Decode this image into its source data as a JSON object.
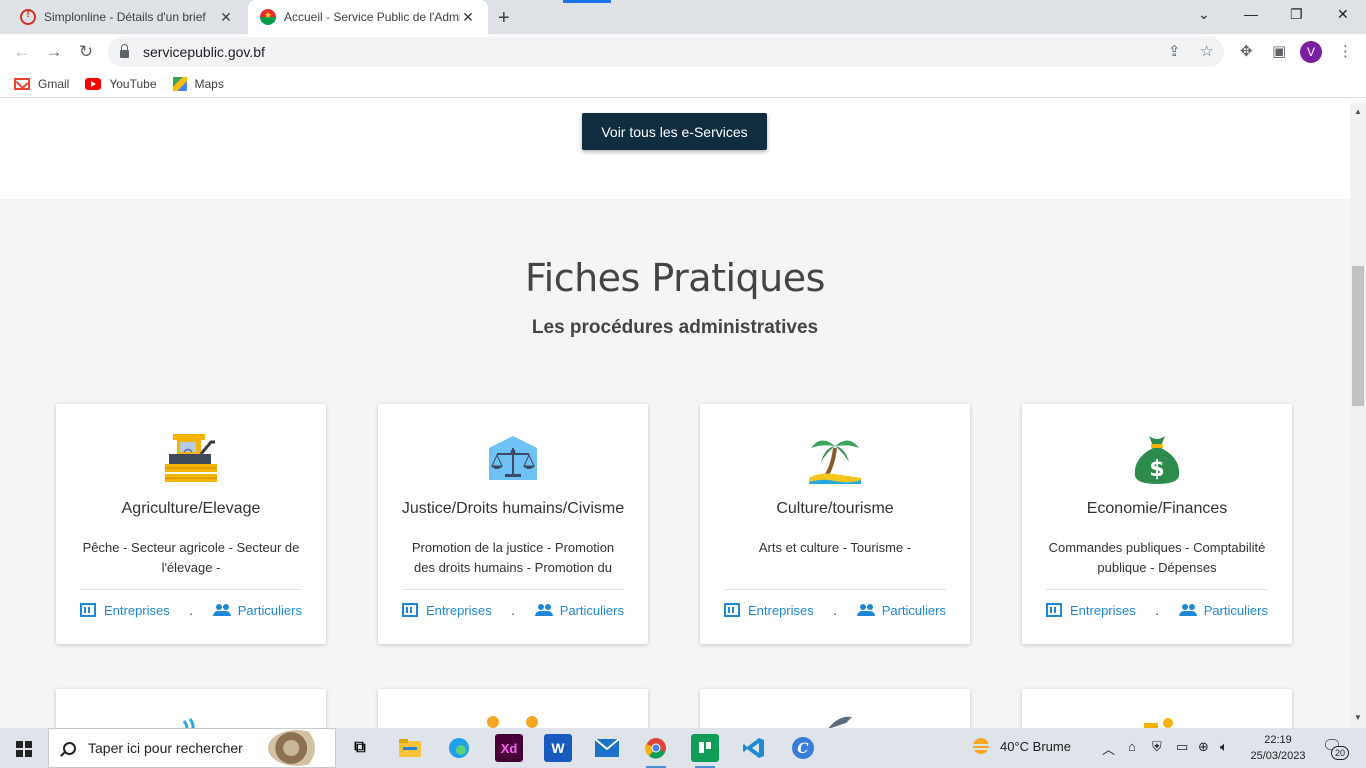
{
  "browser": {
    "tabs": [
      {
        "title": "Simplonline - Détails d'un brief",
        "active": false
      },
      {
        "title": "Accueil - Service Public de l'Admi",
        "active": true
      }
    ],
    "url": "servicepublic.gov.bf",
    "profile_initial": "V",
    "bookmarks": [
      {
        "label": "Gmail",
        "icon": "gmail-icon"
      },
      {
        "label": "YouTube",
        "icon": "youtube-icon"
      },
      {
        "label": "Maps",
        "icon": "maps-icon"
      }
    ]
  },
  "page": {
    "eservices_button": "Voir tous les e-Services",
    "section_title": "Fiches Pratiques",
    "section_subtitle": "Les procédures administratives",
    "link_entreprises": "Entreprises",
    "link_particuliers": "Particuliers",
    "link_separator": ".",
    "cards": [
      {
        "title": "Agriculture/Elevage",
        "description": "Pêche - Secteur agricole - Secteur de l'élevage -",
        "icon": "harvester-icon"
      },
      {
        "title": "Justice/Droits humains/Civisme",
        "description": "Promotion de la justice - Promotion des droits humains - Promotion du",
        "icon": "scales-icon"
      },
      {
        "title": "Culture/tourisme",
        "description": "Arts et culture - Tourisme -",
        "icon": "palm-tree-icon"
      },
      {
        "title": "Economie/Finances",
        "description": "Commandes publiques - Comptabilité publique - Dépenses",
        "icon": "money-bag-icon"
      }
    ]
  },
  "taskbar": {
    "search_placeholder": "Taper ici pour rechercher",
    "weather": "40°C  Brume",
    "time": "22:19",
    "date": "25/03/2023",
    "notification_count": "20",
    "apps": [
      "task-view",
      "file-explorer",
      "edge",
      "adobe-xd",
      "word",
      "mail",
      "chrome",
      "trello",
      "vscode",
      "canva"
    ]
  },
  "colors": {
    "primary_button": "#0f2d3e",
    "link": "#1e88d8",
    "page_background": "#f5f5f5"
  }
}
